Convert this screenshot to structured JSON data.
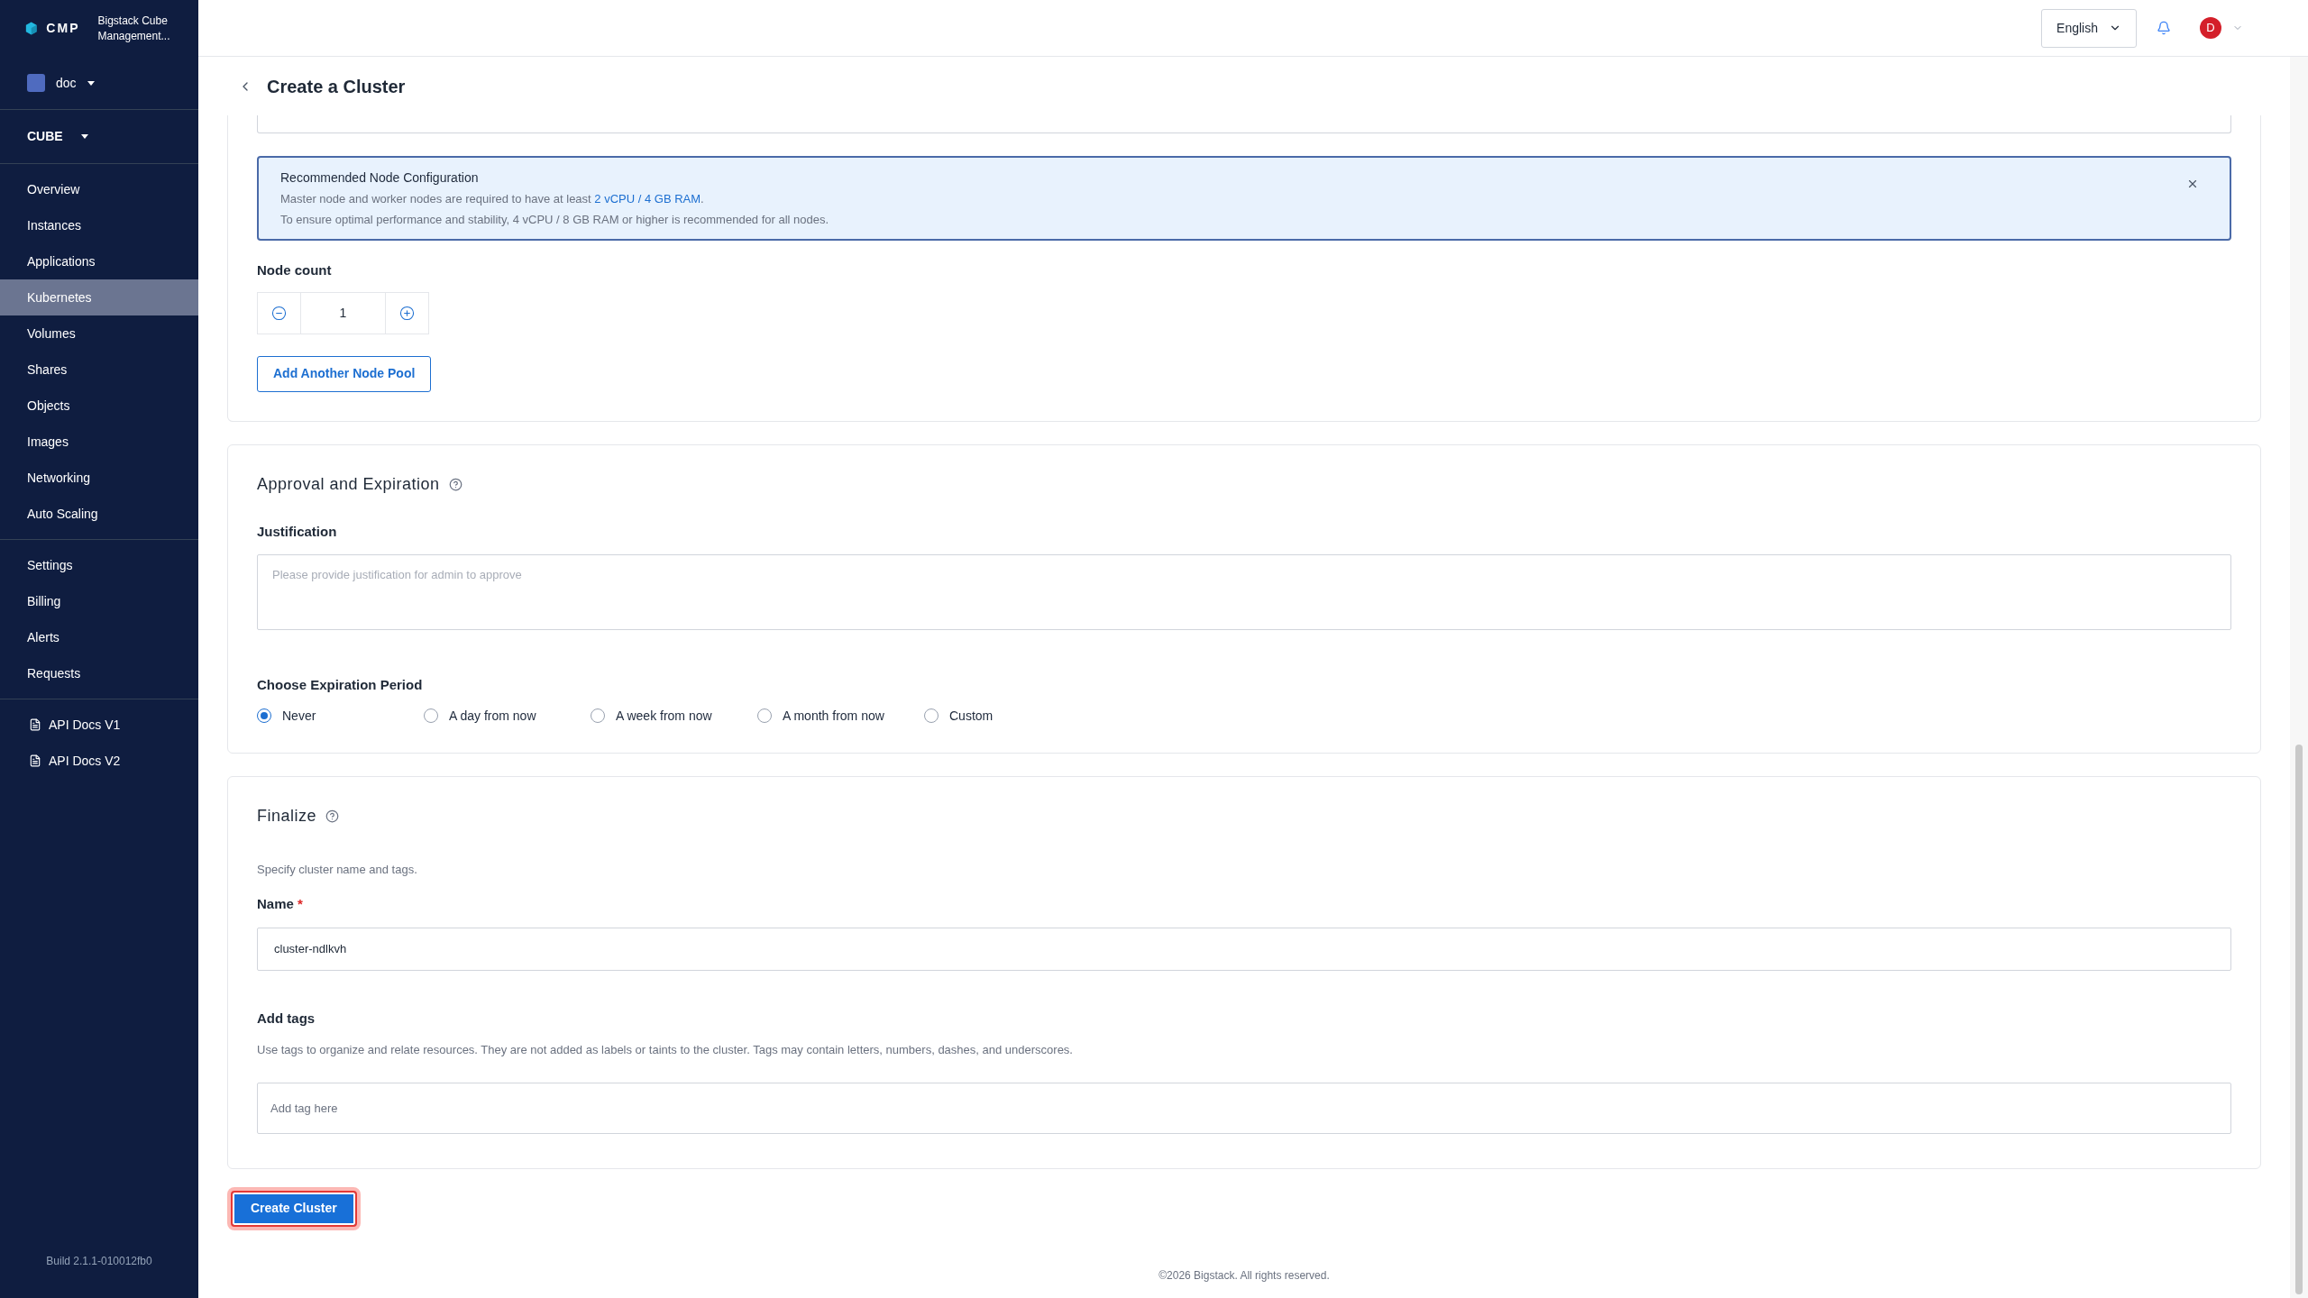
{
  "brand": {
    "logo": "CMP",
    "name": "Bigstack Cube Management..."
  },
  "project": {
    "name": "doc"
  },
  "region": {
    "name": "CUBE"
  },
  "nav_groups": [
    [
      {
        "label": "Overview",
        "selected": false
      },
      {
        "label": "Instances",
        "selected": false
      },
      {
        "label": "Applications",
        "selected": false
      },
      {
        "label": "Kubernetes",
        "selected": true
      },
      {
        "label": "Volumes",
        "selected": false
      },
      {
        "label": "Shares",
        "selected": false
      },
      {
        "label": "Objects",
        "selected": false
      },
      {
        "label": "Images",
        "selected": false
      },
      {
        "label": "Networking",
        "selected": false
      },
      {
        "label": "Auto Scaling",
        "selected": false
      }
    ],
    [
      {
        "label": "Settings",
        "selected": false
      },
      {
        "label": "Billing",
        "selected": false
      },
      {
        "label": "Alerts",
        "selected": false
      },
      {
        "label": "Requests",
        "selected": false
      }
    ]
  ],
  "docs": [
    "API Docs V1",
    "API Docs V2"
  ],
  "build": "Build 2.1.1-010012fb0",
  "topbar": {
    "language": "English",
    "avatar": "D"
  },
  "page_title": "Create a Cluster",
  "notice": {
    "title": "Recommended Node Configuration",
    "line_1": "Master node and worker nodes are required to have at least ",
    "highlight": "2 vCPU / 4 GB RAM",
    "line_1_end": ".",
    "line_2": "To ensure optimal performance and stability, 4 vCPU / 8 GB RAM or higher is recommended for all nodes."
  },
  "node_count": {
    "label": "Node count",
    "value": "1"
  },
  "add_pool_button": "Add Another Node Pool",
  "approval": {
    "title": "Approval and Expiration",
    "justification_label": "Justification",
    "justification_placeholder": "Please provide justification for admin to approve",
    "expiration_label": "Choose Expiration Period",
    "options": [
      {
        "label": "Never",
        "selected": true
      },
      {
        "label": "A day from now",
        "selected": false
      },
      {
        "label": "A week from now",
        "selected": false
      },
      {
        "label": "A month from now",
        "selected": false
      },
      {
        "label": "Custom",
        "selected": false
      }
    ]
  },
  "finalize": {
    "title": "Finalize",
    "description": "Specify cluster name and tags.",
    "name_label": "Name",
    "required_mark": "*",
    "name_value": "cluster-ndlkvh",
    "tags_label": "Add tags",
    "tags_description": "Use tags to organize and relate resources. They are not added as labels or taints to the cluster. Tags may contain letters, numbers, dashes, and underscores.",
    "tags_placeholder": "Add tag here"
  },
  "create_button": "Create Cluster",
  "footer": "©2026 Bigstack. All rights reserved."
}
